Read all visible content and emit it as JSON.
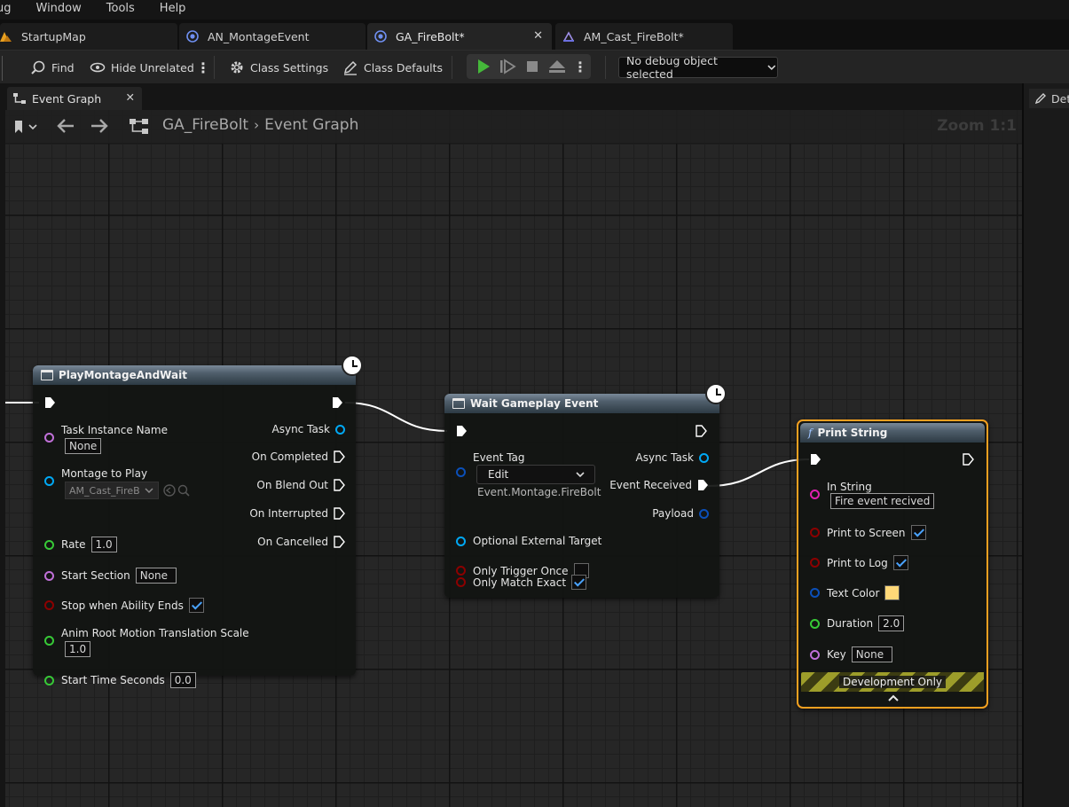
{
  "menu": {
    "items": [
      "ug",
      "Window",
      "Tools",
      "Help"
    ]
  },
  "tabs": [
    {
      "label": "StartupMap",
      "icon": "unreal-level-icon"
    },
    {
      "label": "AN_MontageEvent",
      "icon": "blueprint-icon"
    },
    {
      "label": "GA_FireBolt*",
      "icon": "blueprint-icon",
      "active": true
    },
    {
      "label": "AM_Cast_FireBolt*",
      "icon": "montage-icon"
    }
  ],
  "toolbar": {
    "find": "Find",
    "hide_unrelated": "Hide Unrelated",
    "class_settings": "Class Settings",
    "class_defaults": "Class Defaults",
    "debug_object": "No debug object selected"
  },
  "graph_tab": {
    "label": "Event Graph"
  },
  "details_tab": {
    "label": "Details"
  },
  "breadcrumb": {
    "blueprint": "GA_FireBolt",
    "graph": "Event Graph"
  },
  "zoom": "Zoom 1:1",
  "nodes": {
    "play_montage": {
      "title": "PlayMontageAndWait",
      "task_instance_name": {
        "label": "Task Instance Name",
        "value": "None"
      },
      "montage_to_play": {
        "label": "Montage to Play",
        "value": "AM_Cast_FireB"
      },
      "rate": {
        "label": "Rate",
        "value": "1.0"
      },
      "start_section": {
        "label": "Start Section",
        "value": "None"
      },
      "stop_when_ability_ends": {
        "label": "Stop when Ability Ends",
        "checked": true
      },
      "root_motion_scale": {
        "label": "Anim Root Motion Translation Scale",
        "value": "1.0"
      },
      "start_time": {
        "label": "Start Time Seconds",
        "value": "0.0"
      },
      "outputs": {
        "async_task": "Async Task",
        "on_completed": "On Completed",
        "on_blend_out": "On Blend Out",
        "on_interrupted": "On Interrupted",
        "on_cancelled": "On Cancelled"
      }
    },
    "wait_gameplay_event": {
      "title": "Wait Gameplay Event",
      "event_tag": {
        "label": "Event Tag",
        "edit": "Edit",
        "value": "Event.Montage.FireBolt"
      },
      "optional_external_target": "Optional External Target",
      "only_trigger_once": {
        "label": "Only Trigger Once",
        "checked": false
      },
      "only_match_exact": {
        "label": "Only Match Exact",
        "checked": true
      },
      "outputs": {
        "async_task": "Async Task",
        "event_received": "Event Received",
        "payload": "Payload"
      }
    },
    "print_string": {
      "title": "Print String",
      "in_string": {
        "label": "In String",
        "value": "Fire event recived"
      },
      "print_to_screen": {
        "label": "Print to Screen",
        "checked": true
      },
      "print_to_log": {
        "label": "Print to Log",
        "checked": true
      },
      "text_color": {
        "label": "Text Color",
        "color": "#ffd878"
      },
      "duration": {
        "label": "Duration",
        "value": "2.0"
      },
      "key": {
        "label": "Key",
        "value": "None"
      },
      "dev_only": "Development Only"
    }
  },
  "colors": {
    "pin_object": "#00a8f4",
    "pin_float": "#37c937",
    "pin_name": "#c070d8",
    "pin_bool": "#8c0000",
    "pin_struct": "#0b4fb8",
    "pin_string": "#e020b0",
    "selected_outline": "#f4a020"
  }
}
